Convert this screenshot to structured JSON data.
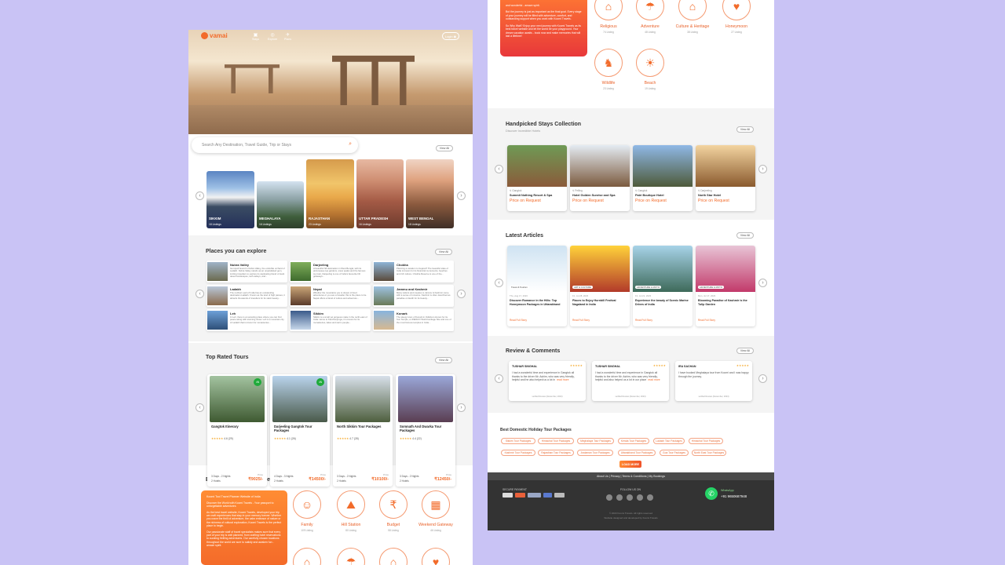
{
  "header": {
    "logo": "vamai",
    "nav": [
      "Stays",
      "Explore",
      "Plans"
    ],
    "login": "Login"
  },
  "search": {
    "placeholder": "Search Any Destination, Travel Guide, Trip or Stays",
    "view_all": "View All"
  },
  "states": [
    {
      "name": "SIKKIM",
      "count": "18 Listings"
    },
    {
      "name": "MEGHALAYA",
      "count": "16 Listings"
    },
    {
      "name": "RAJASTHAN",
      "count": "23 Listings"
    },
    {
      "name": "UTTAR PRADESH",
      "count": "16 Listings"
    },
    {
      "name": "WEST BENGAL",
      "count": "18 Listings"
    }
  ],
  "places": {
    "title": "Places you can explore",
    "view_all": "View All",
    "items": [
      {
        "name": "Nubra Valley",
        "desc": "Get spell bound in Nubra Valley, the erstwhile orchard of Ladakh. Nubra Valley stands as an unparalleled gem, inviting travellers to explore its captivating blend of stark desert landscapes, lush valleys, and..."
      },
      {
        "name": "Darjeeling",
        "desc": "A beautiful hill destination in West Bengal, with its picturesque tea gardens, snow peaks and the famous toy train, Darjeeling is one of India's favourite hill getaways..."
      },
      {
        "name": "Chokha",
        "desc": "Planning a vacation to Gujarat? The beautiful state of India is known for its historical monuments, beaches and rich culture. Chokha Reserve is one of the..."
      },
      {
        "name": "Ladakh",
        "desc": "The northern part of India has an outstanding destination Ladakh. Known as the land of high passes, it attracts thousands of travellers for its stark beauty..."
      },
      {
        "name": "Nepal",
        "desc": "Whether the mountains you to dream of lived adventures or you are a traveller this is the place to be. Nepal offers a blend of culture and adventure..."
      },
      {
        "name": "Jammu and Kashmir",
        "desc": "Many visitors and couples to Jammu & Kashmir come with a sense of romance. Kashmir is often described as paradise on Earth for its beauty..."
      },
      {
        "name": "Leh",
        "desc": "In Leh, there is an amazing place where you can find peace along with stunning views. Leh is a mountain city of Ladakh that is known for monasteries..."
      },
      {
        "name": "Sikkim",
        "desc": "Sikkim is a small yet gorgeous state in the north-east of India. Home to Kanchenjunga, it is known for its monasteries, lakes and warm people..."
      },
      {
        "name": "Konark",
        "desc": "The sleepy town of Konark in Odisha is known for its Sun Temple, a UNESCO World Heritage Site and one of the most famous temples in India..."
      }
    ]
  },
  "tours": {
    "title": "Top Rated Tours",
    "view_all": "View All",
    "items": [
      {
        "name": "Gangtok Itinerary",
        "rating": "4.6 (29)",
        "duration": "3 Days - 2 Nights",
        "hotels": "2 Hotels",
        "price_label": "Price",
        "price": "₹9025/-",
        "badge": "4N"
      },
      {
        "name": "Darjeeling Gangtok Tour Packages",
        "rating": "4.1 (26)",
        "duration": "4 Days - 3 Nights",
        "hotels": "2 Hotels",
        "price_label": "Price",
        "price": "₹14500/-",
        "badge": "4N"
      },
      {
        "name": "North Sikkim Tour Packages",
        "rating": "4.7 (28)",
        "duration": "3 Days - 2 Nights",
        "hotels": "2 Hotels",
        "price_label": "Price",
        "price": "₹10100/-",
        "badge": ""
      },
      {
        "name": "Somnath And Dwarka Tour Packages",
        "rating": "4.4 (22)",
        "duration": "3 Days - 2 Nights",
        "hotels": "2 Hotels",
        "price_label": "Price",
        "price": "₹12450/-",
        "badge": ""
      }
    ]
  },
  "themes": {
    "title": "Explore Holidays By Theme",
    "promo_title": "Koomi Tool Travel Planner Website of India",
    "promo_lines": [
      "Discover the World with Koomi Travels - Your passport to unforgettable adventures",
      "As the best travel website, Koomi Travels, developed your trip we craft experiences that stay in your memory forever. Whether you crave the thrill of adventure, the calm embrace of nature or the richness of cultural exploration, Koomi Travels is the perfect place to begin.",
      "Our passionate staff of travel specialists makes sure that every part of your trip is well planned, from crafting hotel reservations to curating thrilling adventures. Our carefully chosen locations throughout the world are sure to satisfy and awaken fun - amaze spirit.",
      "But the journey is just as important as the final goal. Every stage of your journey will be filled with adventure, comfort, and outstanding support when you work with Koomi Travels.",
      "So Why Wait? Enjoy your next journey with Koomi Travels as its best travel website and let the world be your playground. Your dream vacation awaits - book now and make memories that will last a lifetime!"
    ],
    "top_line": "and wonderful - amaze spirit.",
    "items": [
      {
        "name": "Family",
        "count": "109 Listing",
        "icon": "family-icon"
      },
      {
        "name": "Hill Station",
        "count": "80 Listing",
        "icon": "mountain-icon"
      },
      {
        "name": "Budget",
        "count": "58 Listing",
        "icon": "budget-icon"
      },
      {
        "name": "Weekend Gateway",
        "count": "46 Listing",
        "icon": "calendar-icon"
      },
      {
        "name": "Religious",
        "count": "74 Listing",
        "icon": "temple-icon"
      },
      {
        "name": "Adventure",
        "count": "48 Listing",
        "icon": "paraglide-icon"
      },
      {
        "name": "Culture & Heritage",
        "count": "38 Listing",
        "icon": "heritage-icon"
      },
      {
        "name": "Honeymoon",
        "count": "27 Listing",
        "icon": "couple-icon"
      },
      {
        "name": "Wildlife",
        "count": "23 Listing",
        "icon": "deer-icon"
      },
      {
        "name": "Beach",
        "count": "19 Listing",
        "icon": "beach-icon"
      }
    ]
  },
  "stays": {
    "title": "Handpicked Stays Collection",
    "subtitle": "Discover Incredible Hotels",
    "view_all": "View All",
    "items": [
      {
        "location": "Gangtok",
        "name": "Summit Nothing Resort & Spa",
        "price": "Price on Request"
      },
      {
        "location": "Pelling",
        "name": "Hotel Golden Sunrise and Spa",
        "price": "Price on Request"
      },
      {
        "location": "Gangtok",
        "name": "Patri Boutique Hotel",
        "price": "Price on Request"
      },
      {
        "location": "Darjeeling",
        "name": "North Star Hotel",
        "price": "Price on Request"
      }
    ]
  },
  "articles": {
    "title": "Latest Articles",
    "view_all": "View All",
    "items": [
      {
        "tag": "Travel & Tourism",
        "date": "Thu, Aug 17, 2023",
        "title": "Discover Romance in the Hills: Top Honeymoon Packages in Uttarakhand",
        "link": "Read Full Story"
      },
      {
        "tag": "ART & CULTURE",
        "date": "Fri, Jul 28, 2023",
        "title": "Places to Enjoy Hornbill Festival Nagaland in India",
        "link": "Read Full Story"
      },
      {
        "tag": "ADVENTURE & MOTO",
        "date": "Fri, Jul 21, 2023",
        "title": "Experience the beauty of Scenic Marine Drives of India",
        "link": "Read Full Story"
      },
      {
        "tag": "ADVENTURE & MOTO",
        "date": "Mon, Jul 17, 2023",
        "title": "Blooming Paradise of Kashmir is the Tulip Garden",
        "link": "Read Full Story"
      }
    ]
  },
  "reviews": {
    "title": "Review & Comments",
    "view_all": "View All",
    "items": [
      {
        "name": "TUSHAR SINGHAL",
        "text": "I had a wonderful time and experience in Gangtok all thanks to the driver Mr. Ashim, who was very friendly, helpful and he also helped us a lot in",
        "more": "read more",
        "foot": "verified Review (December, 2023)"
      },
      {
        "name": "TUSHAR SINGHAL",
        "text": "I had a wonderful time and experience in Gangtok all thanks to the driver Mr. Ashim, who was very friendly, helpful and also helped us a lot in our place",
        "more": "read more",
        "foot": "verified Review (December, 2023)"
      },
      {
        "name": "IRA SACHAN",
        "text": "I have booked Meghalaya tour from Koomi and I was happy through the journey.",
        "more": "",
        "foot": "verified Review (December, 2023)"
      }
    ]
  },
  "packages": {
    "title": "Best Domestic Holiday Tour Packages",
    "chips": [
      "Sikkim Tour Packages",
      "Himachal Tour Packages",
      "Meghalaya Tour Packages",
      "Kerala Tour Packages",
      "Ladakh Tour Packages",
      "Himachal Tour Packages",
      "Kashmir Tour Packages",
      "Rajasthan Tour Packages",
      "Andaman Tour Packages",
      "Uttarakhand Tour Packages",
      "Goa Tour Packages",
      "North East Tour Packages"
    ],
    "load_more": "LOAD MORE"
  },
  "footer": {
    "links": "About Us | Privacy | Terms & Conditions | My Bookings",
    "secure": "SECURE PAYMENT",
    "follow": "FOLLOW US ON",
    "whatsapp_label": "WhatsApp",
    "phone": "+91 9650687948",
    "copy1": "© 2023 Koomi Travels. All rights reserved",
    "copy2": "Website designed and developed by Koomi Travels"
  }
}
